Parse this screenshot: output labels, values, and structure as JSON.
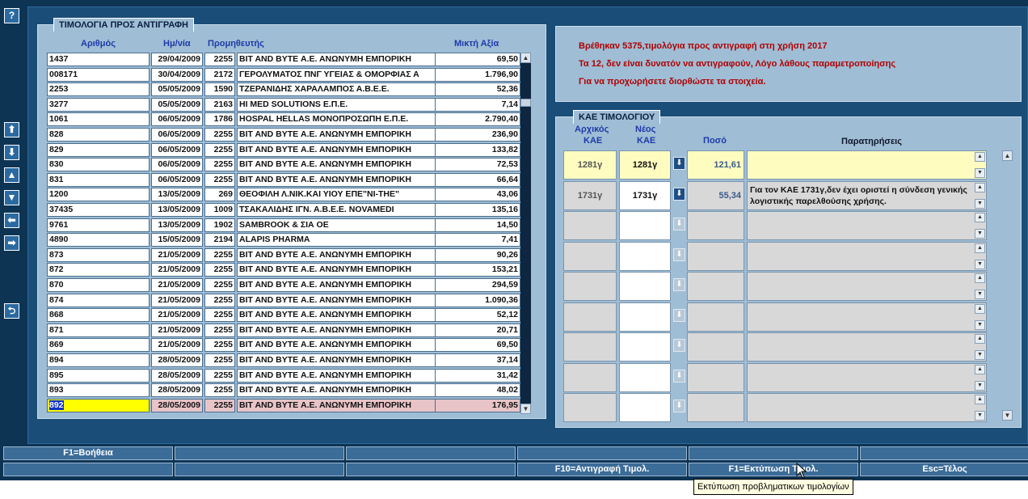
{
  "toolbar": {
    "help_label": "?",
    "buttons": [
      {
        "icon": "arrow-up-bold-icon",
        "glyph": "⬆"
      },
      {
        "icon": "arrow-down-bold-icon",
        "glyph": "⬇"
      },
      {
        "icon": "caret-up-icon",
        "glyph": "▲"
      },
      {
        "icon": "caret-down-icon",
        "glyph": "▼"
      },
      {
        "icon": "arrow-left-icon",
        "glyph": "⬅"
      },
      {
        "icon": "arrow-right-icon",
        "glyph": "➡"
      },
      {
        "icon": "undo-icon",
        "glyph": "⮌"
      }
    ]
  },
  "invoices": {
    "title": "ΤΙΜΟΛΟΓΙΑ ΠΡΟΣ ΑΝΤΙΓΡΑΦΗ",
    "headers": {
      "number": "Αριθμός",
      "date": "Ημ/νία",
      "supplier": "Προμηθευτής",
      "amount": "Μικτή Αξία"
    },
    "rows": [
      {
        "number": "1437",
        "date": "29/04/2009",
        "code": "2255",
        "name": "BIT AND BYTE Α.Ε. ΑΝΩΝΥΜΗ ΕΜΠΟΡΙΚΗ",
        "amount": "69,50"
      },
      {
        "number": "008171",
        "date": "30/04/2009",
        "code": "2172",
        "name": "ΓΕΡΟΛΥΜΑΤΟΣ ΠΝΓ ΥΓΕΙΑΣ & ΟΜΟΡΦΙΑΣ Α",
        "amount": "1.796,90"
      },
      {
        "number": "2253",
        "date": "05/05/2009",
        "code": "1590",
        "name": "ΤΖΕΡΑΝΙΔΗΣ ΧΑΡΑΛΑΜΠΟΣ Α.Β.Ε.Ε.",
        "amount": "52,36"
      },
      {
        "number": "3277",
        "date": "05/05/2009",
        "code": "2163",
        "name": "HI MED SOLUTIONS Ε.Π.Ε.",
        "amount": "7,14"
      },
      {
        "number": "1061",
        "date": "06/05/2009",
        "code": "1786",
        "name": "HOSPAL HELLAS ΜΟΝΟΠΡΟΣΩΠΗ Ε.Π.Ε.",
        "amount": "2.790,40"
      },
      {
        "number": "828",
        "date": "06/05/2009",
        "code": "2255",
        "name": "BIT AND BYTE Α.Ε. ΑΝΩΝΥΜΗ ΕΜΠΟΡΙΚΗ",
        "amount": "236,90"
      },
      {
        "number": "829",
        "date": "06/05/2009",
        "code": "2255",
        "name": "BIT AND BYTE Α.Ε. ΑΝΩΝΥΜΗ ΕΜΠΟΡΙΚΗ",
        "amount": "133,82"
      },
      {
        "number": "830",
        "date": "06/05/2009",
        "code": "2255",
        "name": "BIT AND BYTE Α.Ε. ΑΝΩΝΥΜΗ ΕΜΠΟΡΙΚΗ",
        "amount": "72,53"
      },
      {
        "number": "831",
        "date": "06/05/2009",
        "code": "2255",
        "name": "BIT AND BYTE Α.Ε. ΑΝΩΝΥΜΗ ΕΜΠΟΡΙΚΗ",
        "amount": "66,64"
      },
      {
        "number": "1200",
        "date": "13/05/2009",
        "code": "269",
        "name": "ΘΕΟΦΙΛΗ Λ.ΝΙΚ.ΚΑΙ ΥΙΟΥ ΕΠΕ\"NI-THE\"",
        "amount": "43,06"
      },
      {
        "number": "37435",
        "date": "13/05/2009",
        "code": "1009",
        "name": "ΤΣΑΚΑΛΙΔΗΣ ΙΓΝ.   Α.Β.Ε.Ε. NOVAMEDI",
        "amount": "135,16"
      },
      {
        "number": "9761",
        "date": "13/05/2009",
        "code": "1902",
        "name": "SAMBROOK & ΣΙΑ ΟΕ",
        "amount": "14,50"
      },
      {
        "number": "4890",
        "date": "15/05/2009",
        "code": "2194",
        "name": "ALAPIS PHARMA",
        "amount": "7,41"
      },
      {
        "number": "873",
        "date": "21/05/2009",
        "code": "2255",
        "name": "BIT AND BYTE Α.Ε. ΑΝΩΝΥΜΗ ΕΜΠΟΡΙΚΗ",
        "amount": "90,26"
      },
      {
        "number": "872",
        "date": "21/05/2009",
        "code": "2255",
        "name": "BIT AND BYTE Α.Ε. ΑΝΩΝΥΜΗ ΕΜΠΟΡΙΚΗ",
        "amount": "153,21"
      },
      {
        "number": "870",
        "date": "21/05/2009",
        "code": "2255",
        "name": "BIT AND BYTE Α.Ε. ΑΝΩΝΥΜΗ ΕΜΠΟΡΙΚΗ",
        "amount": "294,59"
      },
      {
        "number": "874",
        "date": "21/05/2009",
        "code": "2255",
        "name": "BIT AND BYTE Α.Ε. ΑΝΩΝΥΜΗ ΕΜΠΟΡΙΚΗ",
        "amount": "1.090,36"
      },
      {
        "number": "868",
        "date": "21/05/2009",
        "code": "2255",
        "name": "BIT AND BYTE Α.Ε. ΑΝΩΝΥΜΗ ΕΜΠΟΡΙΚΗ",
        "amount": "52,12"
      },
      {
        "number": "871",
        "date": "21/05/2009",
        "code": "2255",
        "name": "BIT AND BYTE Α.Ε. ΑΝΩΝΥΜΗ ΕΜΠΟΡΙΚΗ",
        "amount": "20,71"
      },
      {
        "number": "869",
        "date": "21/05/2009",
        "code": "2255",
        "name": "BIT AND BYTE Α.Ε. ΑΝΩΝΥΜΗ ΕΜΠΟΡΙΚΗ",
        "amount": "69,50"
      },
      {
        "number": "894",
        "date": "28/05/2009",
        "code": "2255",
        "name": "BIT AND BYTE Α.Ε. ΑΝΩΝΥΜΗ ΕΜΠΟΡΙΚΗ",
        "amount": "37,14"
      },
      {
        "number": "895",
        "date": "28/05/2009",
        "code": "2255",
        "name": "BIT AND BYTE Α.Ε. ΑΝΩΝΥΜΗ ΕΜΠΟΡΙΚΗ",
        "amount": "31,42"
      },
      {
        "number": "893",
        "date": "28/05/2009",
        "code": "2255",
        "name": "BIT AND BYTE Α.Ε. ΑΝΩΝΥΜΗ ΕΜΠΟΡΙΚΗ",
        "amount": "48,02"
      },
      {
        "number": "892",
        "date": "28/05/2009",
        "code": "2255",
        "name": "BIT AND BYTE Α.Ε. ΑΝΩΝΥΜΗ ΕΜΠΟΡΙΚΗ",
        "amount": "176,95",
        "selected": true
      }
    ]
  },
  "messages": {
    "line1": "Βρέθηκαν  5375,τιμολόγια προς αντιγραφή στη χρήση 2017",
    "line2": "Τα  12, δεν είναι δυνατόν να αντιγραφούν, Λόγο λάθους παραμετροποίησης",
    "line3": "Για να προχωρήσετε διορθώστε τα στοιχεία."
  },
  "kae": {
    "title": "ΚΑΕ ΤΙΜΟΛΟΓΙΟΥ",
    "headers": {
      "original_l1": "Αρχικός",
      "original_l2": "ΚΑΕ",
      "new_l1": "Νέος",
      "new_l2": "ΚΑΕ",
      "amount": "Ποσό",
      "notes": "Παρατηρήσεις"
    },
    "rows": [
      {
        "original": "1281γ",
        "new": "1281γ",
        "amount": "121,61",
        "note": "",
        "highlight": true
      },
      {
        "original": "1731γ",
        "new": "1731γ",
        "amount": "55,34",
        "note": "Για τον ΚΑΕ 1731γ,δεν έχει οριστεί η σύνδεση γενικής λογιστικής παρελθούσης χρήσης."
      },
      {
        "original": "",
        "new": "",
        "amount": "",
        "note": ""
      },
      {
        "original": "",
        "new": "",
        "amount": "",
        "note": ""
      },
      {
        "original": "",
        "new": "",
        "amount": "",
        "note": ""
      },
      {
        "original": "",
        "new": "",
        "amount": "",
        "note": ""
      },
      {
        "original": "",
        "new": "",
        "amount": "",
        "note": ""
      },
      {
        "original": "",
        "new": "",
        "amount": "",
        "note": ""
      },
      {
        "original": "",
        "new": "",
        "amount": "",
        "note": ""
      }
    ]
  },
  "function_keys": {
    "row1": [
      "F1=Βοήθεια",
      "",
      "",
      "",
      "",
      ""
    ],
    "row2": [
      "",
      "",
      "",
      "F10=Αντιγραφή Τιμολ.",
      "F1=Εκτύπωση Τιμολ.",
      "Esc=Τέλος"
    ]
  },
  "tooltip": "Εκτύπωση προβληματικων τιμολογίων"
}
